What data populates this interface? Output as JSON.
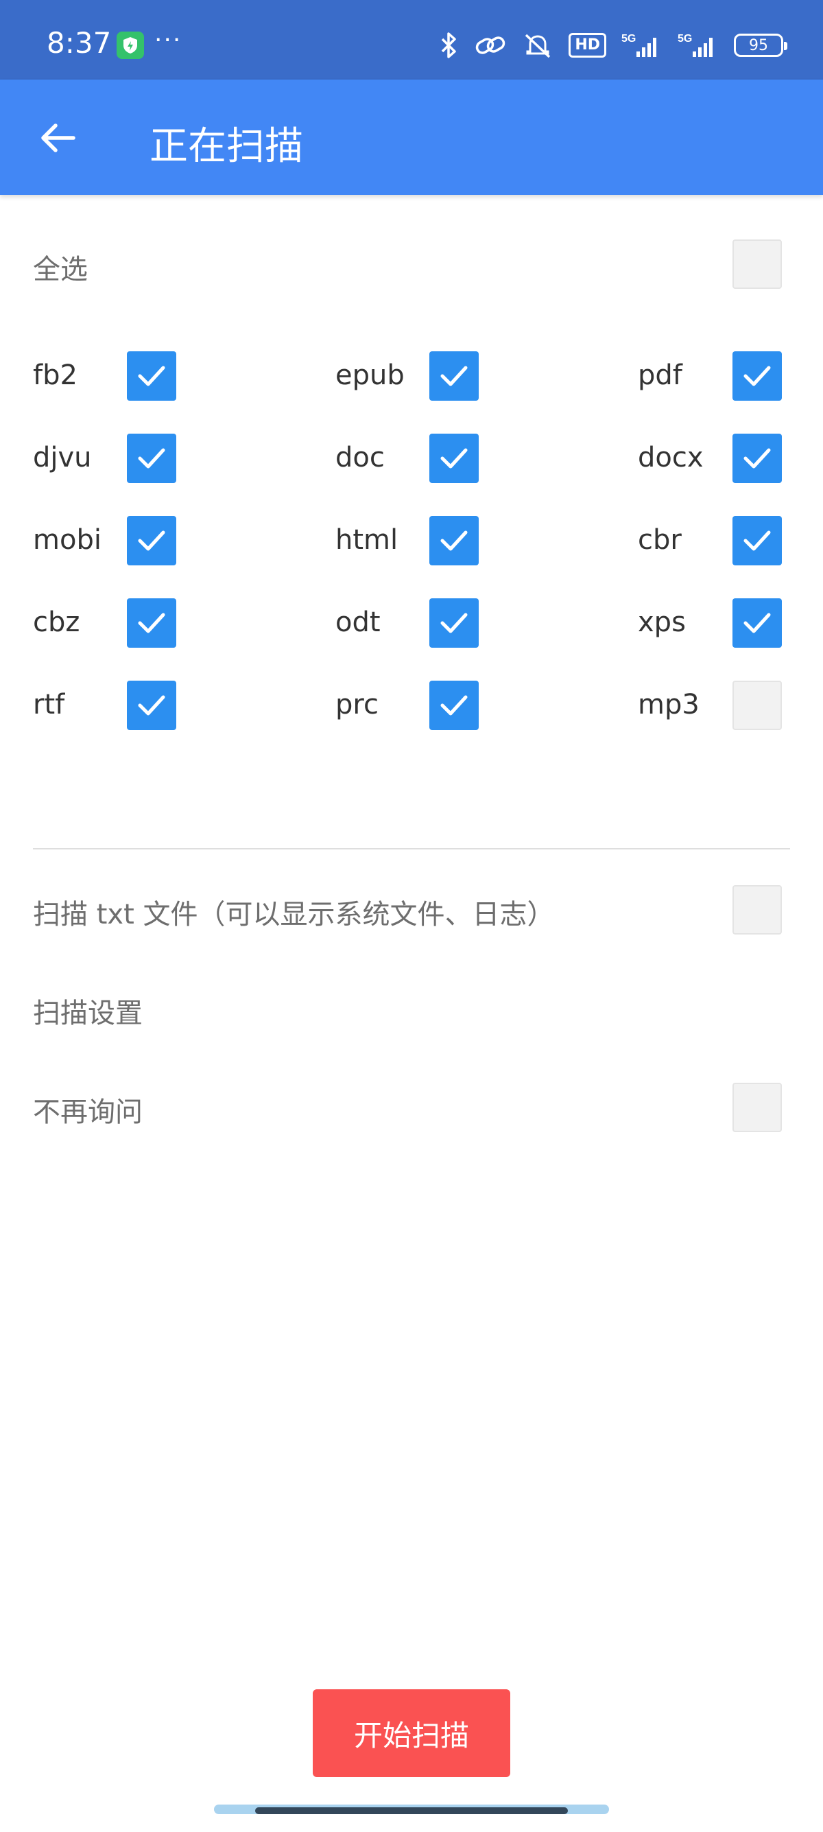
{
  "status_bar": {
    "time": "8:37",
    "dots": "···",
    "hd": "HD",
    "net1": "5G",
    "net2": "5G",
    "battery": "95",
    "icons": [
      "shield-icon",
      "bluetooth-icon",
      "link-icon",
      "silent-icon",
      "signal-icon",
      "battery-icon"
    ]
  },
  "app_bar": {
    "title": "正在扫描",
    "back_icon": "arrow-left-icon"
  },
  "select_all": {
    "label": "全选",
    "checked": false
  },
  "formats": [
    {
      "label": "fb2",
      "checked": true
    },
    {
      "label": "epub",
      "checked": true
    },
    {
      "label": "pdf",
      "checked": true
    },
    {
      "label": "djvu",
      "checked": true
    },
    {
      "label": "doc",
      "checked": true
    },
    {
      "label": "docx",
      "checked": true
    },
    {
      "label": "mobi",
      "checked": true
    },
    {
      "label": "html",
      "checked": true
    },
    {
      "label": "cbr",
      "checked": true
    },
    {
      "label": "cbz",
      "checked": true
    },
    {
      "label": "odt",
      "checked": true
    },
    {
      "label": "xps",
      "checked": true
    },
    {
      "label": "rtf",
      "checked": true
    },
    {
      "label": "prc",
      "checked": true
    },
    {
      "label": "mp3",
      "checked": false
    }
  ],
  "scan_txt": {
    "label": "扫描 txt 文件（可以显示系统文件、日志）",
    "checked": false
  },
  "scan_settings": {
    "label": "扫描设置"
  },
  "dont_ask": {
    "label": "不再询问",
    "checked": false
  },
  "start_button": {
    "label": "开始扫描"
  },
  "colors": {
    "status_bar": "#3a6cc9",
    "app_bar": "#4287f5",
    "checkbox_on": "#2c8ff0",
    "start_button": "#fa5252"
  }
}
